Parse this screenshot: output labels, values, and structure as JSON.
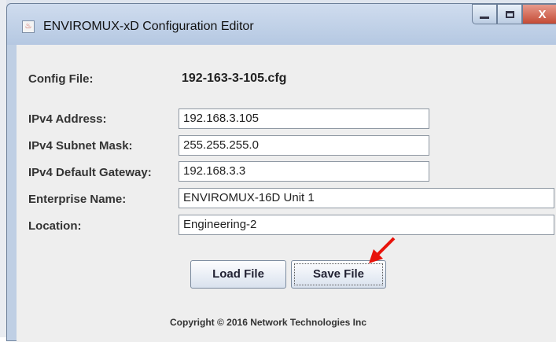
{
  "window": {
    "title": "ENVIROMUX-xD Configuration Editor",
    "close_symbol": "X"
  },
  "form": {
    "config_file_label": "Config File:",
    "config_file_value": "192-163-3-105.cfg",
    "ipv4_address_label": "IPv4 Address:",
    "ipv4_address_value": "192.168.3.105",
    "subnet_mask_label": "IPv4 Subnet Mask:",
    "subnet_mask_value": "255.255.255.0",
    "gateway_label": "IPv4 Default Gateway:",
    "gateway_value": "192.168.3.3",
    "enterprise_name_label": "Enterprise Name:",
    "enterprise_name_value": "ENVIROMUX-16D Unit 1",
    "location_label": "Location:",
    "location_value": "Engineering-2"
  },
  "buttons": {
    "load_label": "Load File",
    "save_label": "Save File"
  },
  "footer": {
    "copyright": "Copyright © 2016 Network Technologies Inc"
  },
  "annotation": {
    "arrow_color": "#e8130b"
  }
}
